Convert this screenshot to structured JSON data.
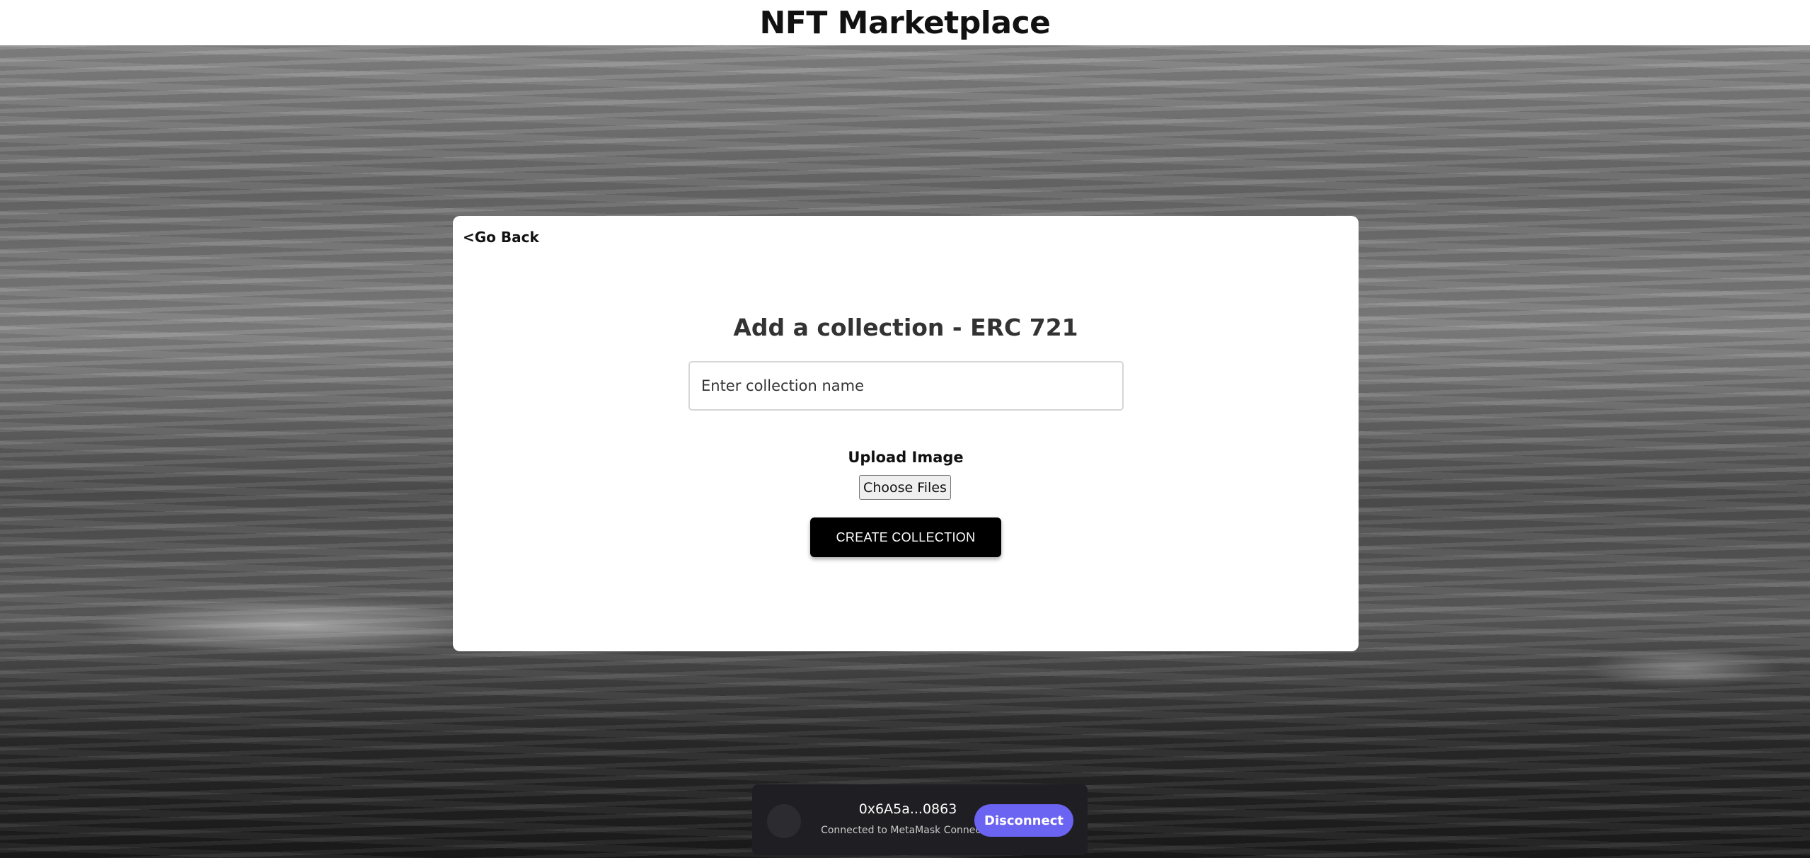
{
  "header": {
    "title": "NFT Marketplace"
  },
  "card": {
    "go_back": "<Go Back",
    "title": "Add a collection - ERC 721",
    "name_input": {
      "value": "",
      "placeholder": "Enter collection name"
    },
    "upload_label": "Upload Image",
    "choose_files_label": "Choose Files",
    "create_button_label": "CREATE COLLECTION"
  },
  "wallet": {
    "address": "0x6A5a...0863",
    "status": "Connected to MetaMask Connector",
    "disconnect_label": "Disconnect"
  },
  "colors": {
    "accent": "#6b63f2",
    "primary_button": "#000000",
    "wallet_bar": "#1f1f23"
  },
  "icons": {
    "wallet_avatar": "avatar-circle"
  }
}
